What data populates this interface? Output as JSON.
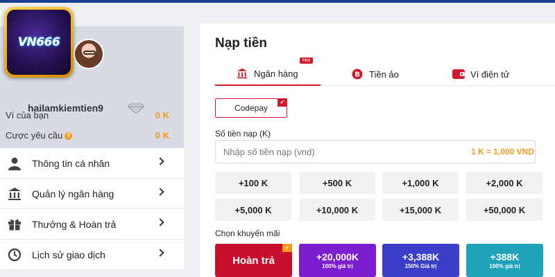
{
  "brand": {
    "logo_text": "VN666"
  },
  "profile": {
    "username": "hailamkiemtien9",
    "wallet_label": "Ví của bạn",
    "wallet_value": "0 K",
    "bet_label": "Cược yêu cầu",
    "bet_value": "0 K"
  },
  "menu": {
    "items": [
      {
        "label": "Thông tin cá nhân",
        "icon": "user-icon"
      },
      {
        "label": "Quản lý ngân hàng",
        "icon": "bank-icon"
      },
      {
        "label": "Thưởng & Hoàn trả",
        "icon": "gift-icon"
      },
      {
        "label": "Lịch sử giao dịch",
        "icon": "history-icon"
      }
    ]
  },
  "deposit": {
    "title": "Nạp tiền",
    "tabs": [
      {
        "label": "Ngân hàng",
        "icon": "bank-icon",
        "badge": "Hot"
      },
      {
        "label": "Tiền ảo",
        "icon": "bitcoin-icon"
      },
      {
        "label": "Ví điện tử",
        "icon": "e-wallet-icon"
      }
    ],
    "method": "Codepay",
    "amount_label": "Số tiền nạp (K)",
    "amount_placeholder": "Nhập số tiền nạp (vnd)",
    "rate_text": "1 K = 1,000 VND",
    "quick_amounts": [
      "+100 K",
      "+500 K",
      "+1,000 K",
      "+2,000 K",
      "+5,000 K",
      "+10,000 K",
      "+15,000 K",
      "+50,000 K"
    ],
    "promo_label": "Chọn khuyến mãi",
    "promos": [
      {
        "big": "Hoàn trả",
        "small": "",
        "color": "#c8102e"
      },
      {
        "big": "+20,000K",
        "small": "100% giá trị",
        "color": "#7d1fd1"
      },
      {
        "big": "+3,388K",
        "small": "150% Giá trị",
        "color": "#3b3fc8"
      },
      {
        "big": "+388K",
        "small": "100% giá trị",
        "color": "#1fa3b8"
      }
    ]
  },
  "colors": {
    "accent": "#d3192c",
    "gold": "#f39a1c",
    "navy": "#1d3d8f"
  }
}
